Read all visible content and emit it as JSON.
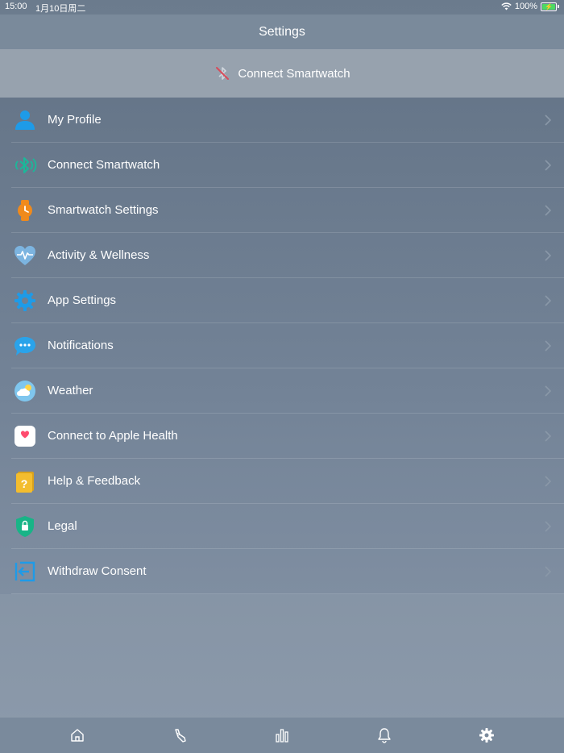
{
  "status_bar": {
    "time": "15:00",
    "date": "1月10日周二",
    "battery": "100%",
    "wifi_icon": "wifi-icon",
    "battery_icon": "battery-charging-icon"
  },
  "header": {
    "title": "Settings"
  },
  "connect_banner": {
    "label": "Connect Smartwatch",
    "icon": "bluetooth-off-icon",
    "icon_color": "#d84b5a"
  },
  "settings": {
    "items": [
      {
        "label": "My Profile",
        "icon": "profile-icon"
      },
      {
        "label": "Connect Smartwatch",
        "icon": "bluetooth-icon"
      },
      {
        "label": "Smartwatch Settings",
        "icon": "watch-icon"
      },
      {
        "label": "Activity & Wellness",
        "icon": "heart-pulse-icon"
      },
      {
        "label": "App Settings",
        "icon": "gear-icon"
      },
      {
        "label": "Notifications",
        "icon": "chat-bubble-icon"
      },
      {
        "label": "Weather",
        "icon": "weather-icon"
      },
      {
        "label": "Connect to Apple Health",
        "icon": "apple-health-icon"
      },
      {
        "label": "Help & Feedback",
        "icon": "help-book-icon"
      },
      {
        "label": "Legal",
        "icon": "shield-lock-icon"
      },
      {
        "label": "Withdraw Consent",
        "icon": "withdraw-icon"
      }
    ]
  },
  "tab_bar": {
    "tabs": [
      {
        "name": "home",
        "icon": "home-icon"
      },
      {
        "name": "activity",
        "icon": "shoe-icon"
      },
      {
        "name": "stats",
        "icon": "bar-chart-icon"
      },
      {
        "name": "alerts",
        "icon": "bell-icon"
      },
      {
        "name": "settings",
        "icon": "gear-icon",
        "active": true
      }
    ]
  },
  "colors": {
    "header_bg": "#7a8a9b",
    "banner_bg": "#97a2ae",
    "accent_blue": "#1e9be8",
    "accent_teal": "#1bb89a",
    "accent_orange": "#f08a1c"
  }
}
